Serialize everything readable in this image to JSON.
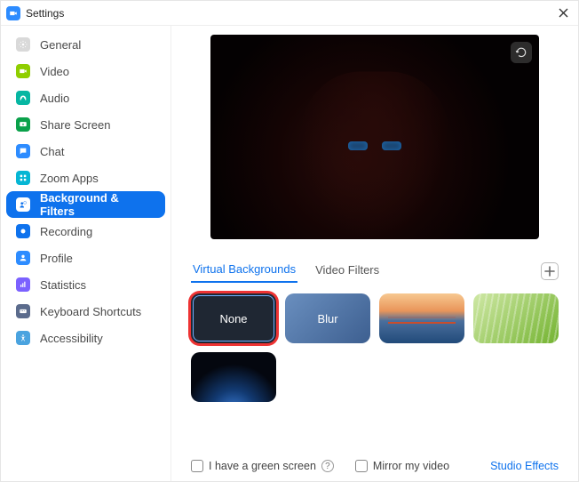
{
  "window": {
    "title": "Settings"
  },
  "sidebar": {
    "items": [
      {
        "label": "General"
      },
      {
        "label": "Video"
      },
      {
        "label": "Audio"
      },
      {
        "label": "Share Screen"
      },
      {
        "label": "Chat"
      },
      {
        "label": "Zoom Apps"
      },
      {
        "label": "Background & Filters"
      },
      {
        "label": "Recording"
      },
      {
        "label": "Profile"
      },
      {
        "label": "Statistics"
      },
      {
        "label": "Keyboard Shortcuts"
      },
      {
        "label": "Accessibility"
      }
    ],
    "active_index": 6
  },
  "tabs": {
    "virtual_backgrounds": "Virtual Backgrounds",
    "video_filters": "Video Filters",
    "active": "virtual_backgrounds"
  },
  "backgrounds": {
    "none_label": "None",
    "blur_label": "Blur",
    "selected": "none"
  },
  "footer": {
    "green_screen_label": "I have a green screen",
    "mirror_label": "Mirror my video",
    "studio_effects_label": "Studio Effects"
  }
}
